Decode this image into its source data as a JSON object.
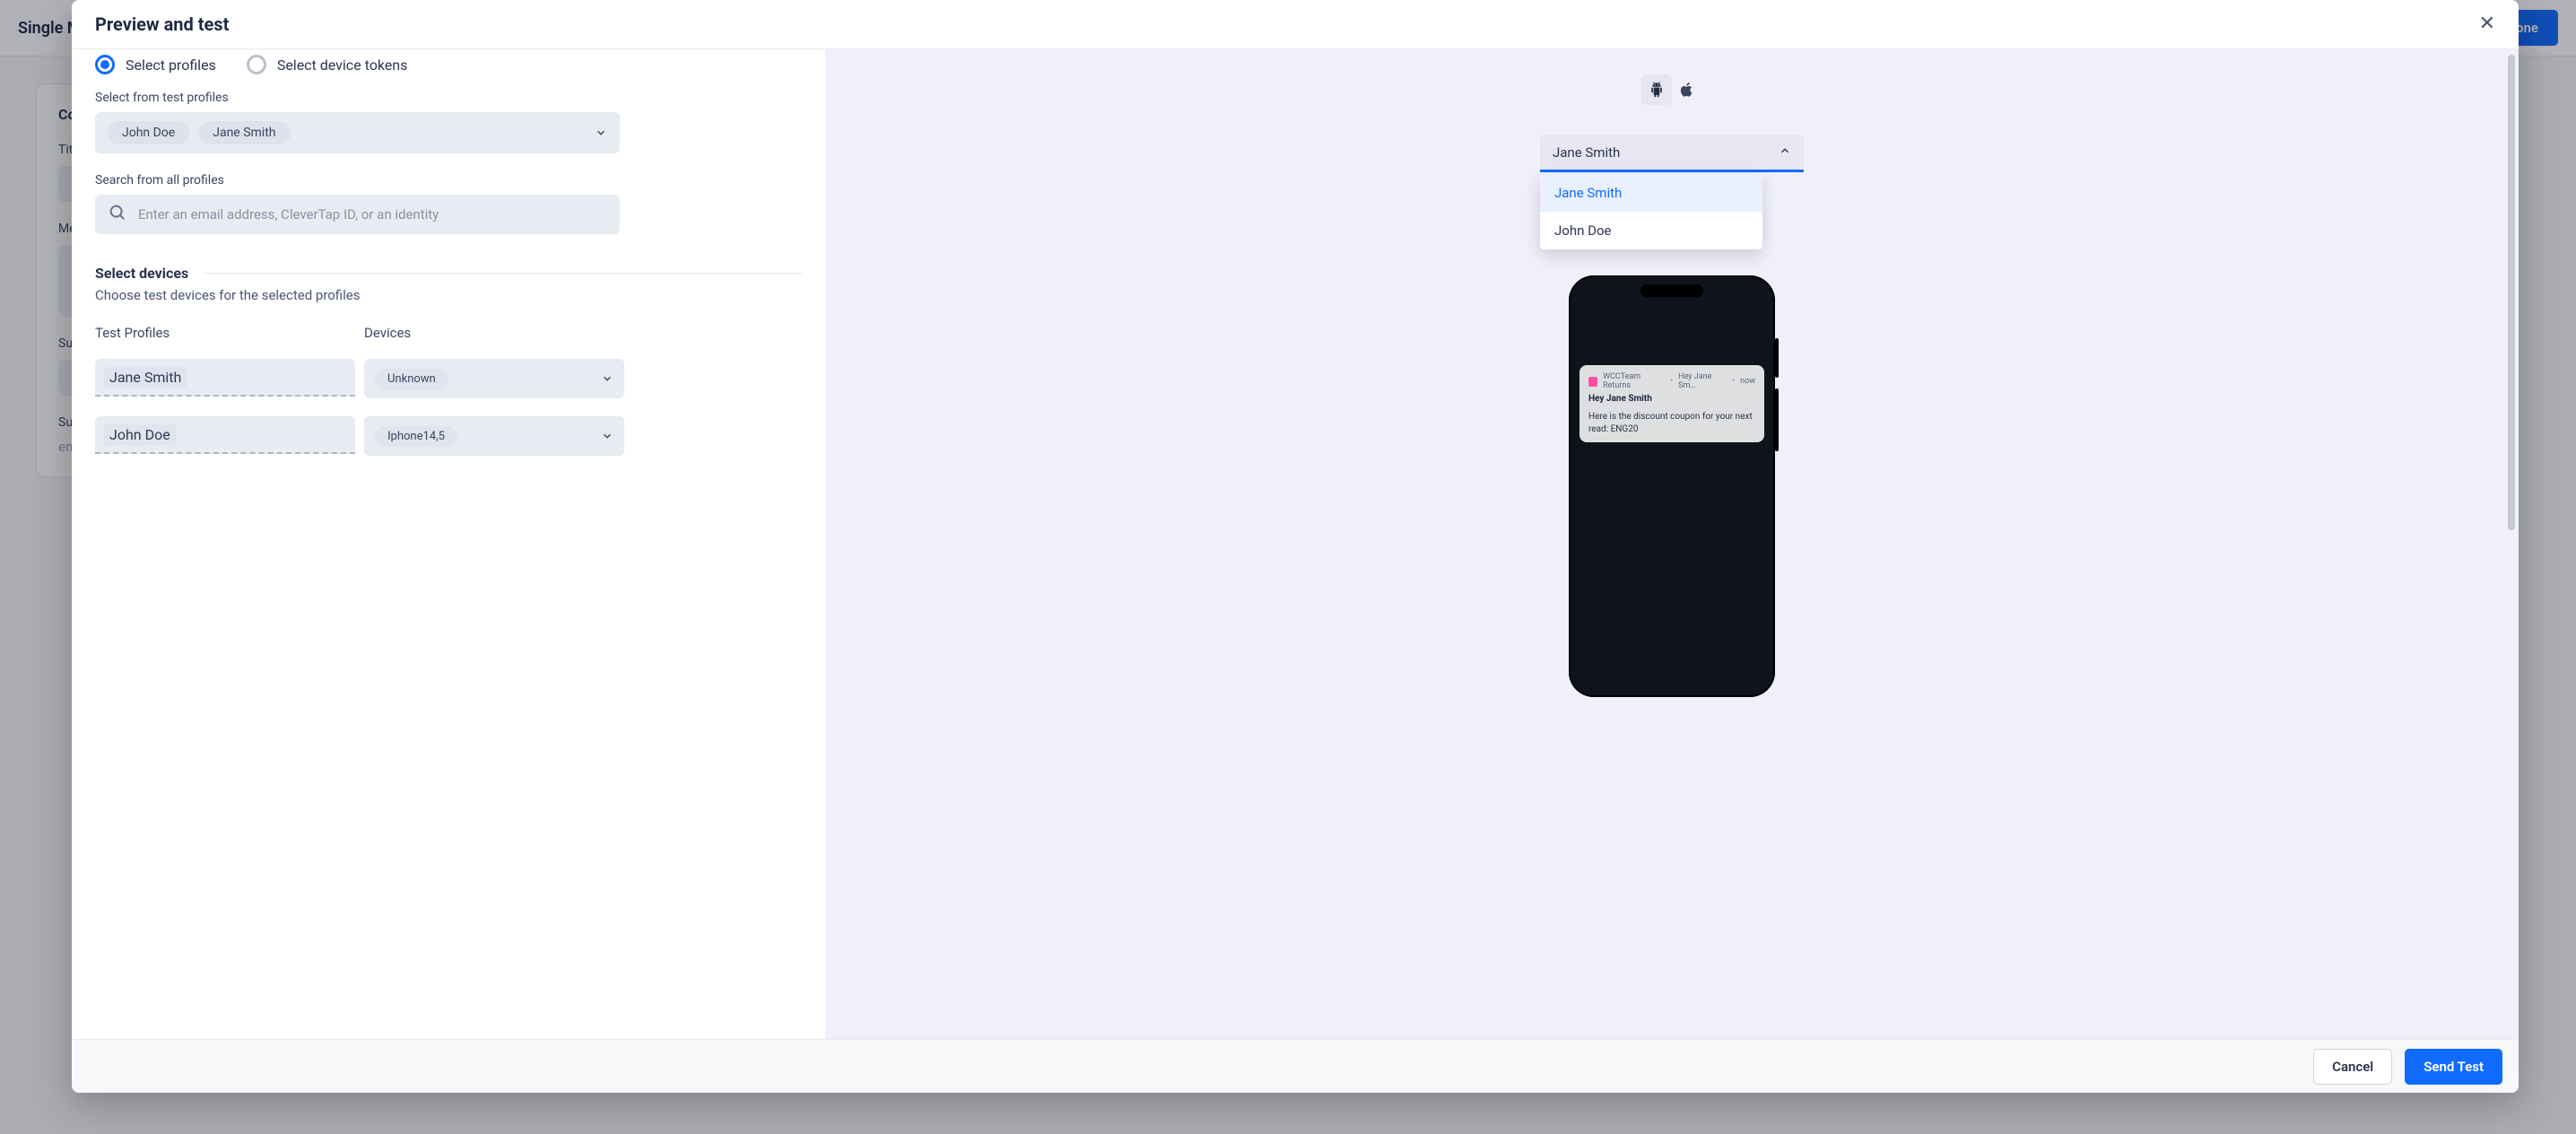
{
  "background": {
    "page_title": "Single M",
    "done_label": "Done",
    "content_heading": "Con",
    "labels": {
      "title": "Tit",
      "message": "Me",
      "subtitle": "Su",
      "summary": "Su"
    },
    "summary_placeholder": "enter summary text",
    "brace_icon": "{ }",
    "at_icon": "@"
  },
  "modal": {
    "title": "Preview and test",
    "close_glyph": "✕",
    "radios": {
      "profiles": "Select profiles",
      "tokens": "Select device tokens"
    },
    "test_profiles_label": "Select from test profiles",
    "profiles_selected": [
      "John Doe",
      "Jane Smith"
    ],
    "search_label": "Search from all profiles",
    "search_placeholder": "Enter an email address, CleverTap ID, or an identity",
    "devices_section_heading": "Select devices",
    "devices_subtext": "Choose test devices for the selected profiles",
    "columns": {
      "profiles": "Test Profiles",
      "devices": "Devices"
    },
    "rows": [
      {
        "profile": "Jane Smith",
        "device": "Unknown"
      },
      {
        "profile": "John Doe",
        "device": "Iphone14,5"
      }
    ],
    "footer": {
      "cancel": "Cancel",
      "send": "Send Test"
    }
  },
  "preview": {
    "os": {
      "android": "android",
      "apple": "apple"
    },
    "dropdown_selected": "Jane Smith",
    "dropdown_items": [
      "Jane Smith",
      "John Doe"
    ],
    "notification": {
      "app": "WCCTeam Returns",
      "subject_abbrev": "Hey Jane Sm…",
      "time": "now",
      "title": "Hey Jane Smith",
      "body": "Here is the discount coupon for your next read: ENG20"
    }
  }
}
